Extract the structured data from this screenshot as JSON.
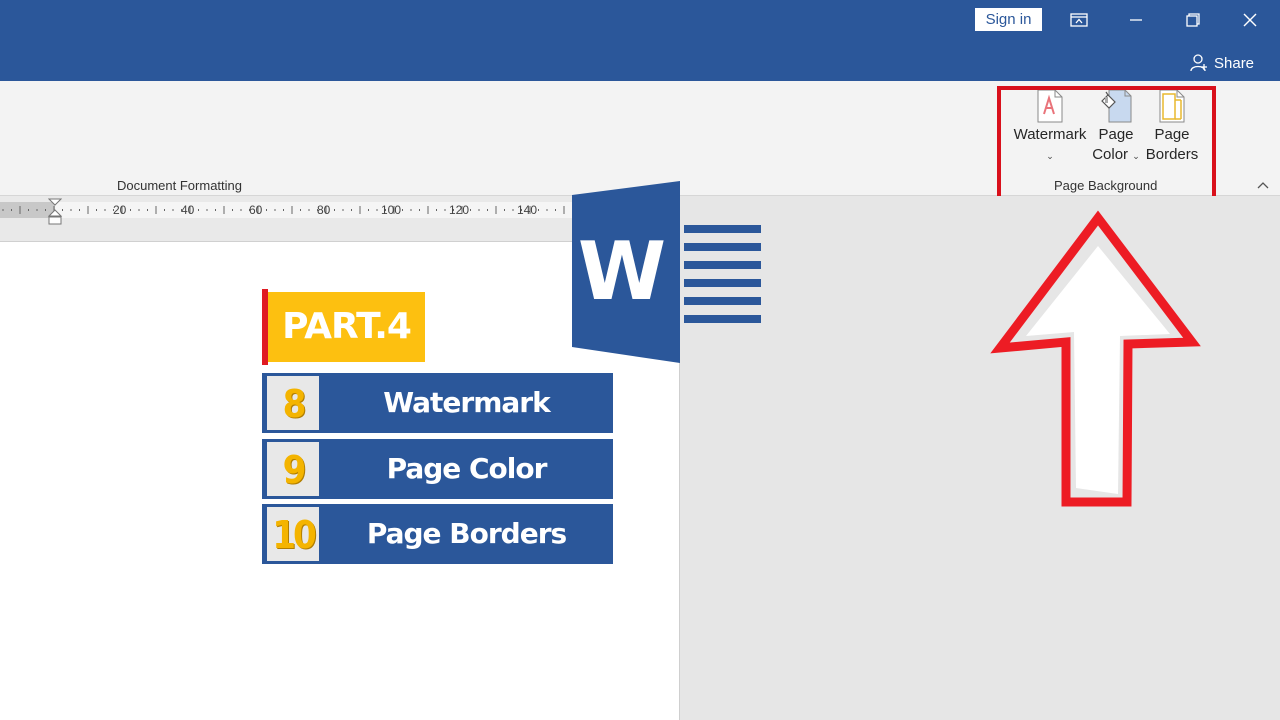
{
  "titlebar": {
    "sign_in_label": "Sign in",
    "share_label": "Share"
  },
  "ribbon": {
    "document_formatting_label": "Document Formatting",
    "page_background_label": "Page Background",
    "buttons": {
      "watermark": "Watermark",
      "page_color_line1": "Page",
      "page_color_line2": "Color",
      "page_borders_line1": "Page",
      "page_borders_line2": "Borders"
    }
  },
  "ruler": {
    "ticks": [
      "20",
      "40",
      "60",
      "80",
      "100",
      "120",
      "140"
    ]
  },
  "document": {
    "part_title": "PART.4",
    "items": [
      {
        "number": "8",
        "label": "Watermark"
      },
      {
        "number": "9",
        "label": "Page Color"
      },
      {
        "number": "10",
        "label": "Page Borders"
      }
    ]
  },
  "colors": {
    "word_blue": "#2b579a",
    "accent_yellow": "#fdc010",
    "highlight_red": "#d9101b",
    "arrow_red": "#ed1c24"
  }
}
